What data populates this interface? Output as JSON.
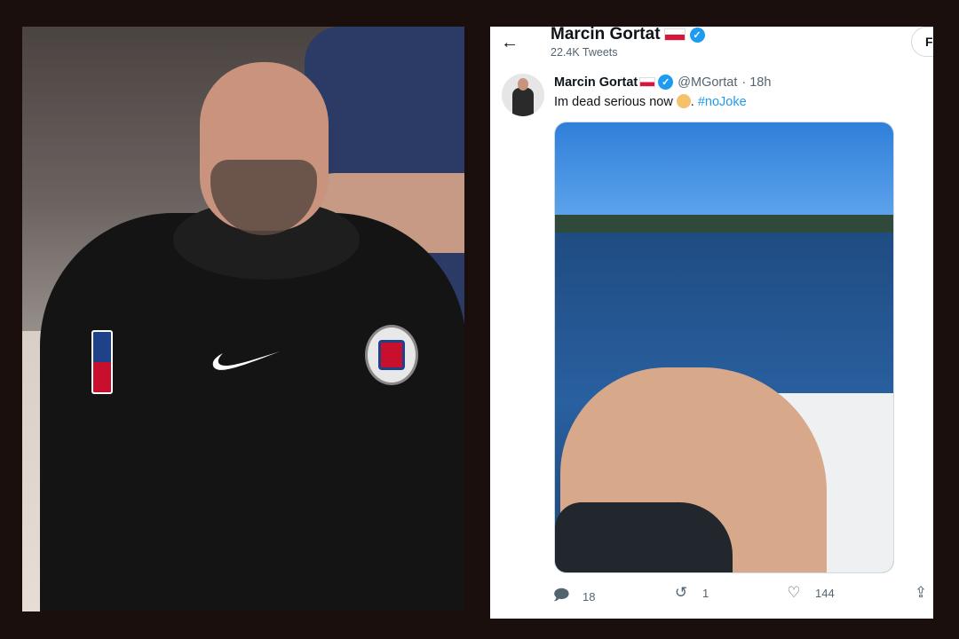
{
  "header": {
    "back_icon": "arrow-left-icon",
    "name": "Marcin Gortat",
    "tweet_count": "22.4K Tweets",
    "follow_label": "F"
  },
  "tweet": {
    "name": "Marcin Gortat",
    "handle": "@MGortat",
    "time": "· 18h",
    "text": "Im dead serious now",
    "text_sep": ". ",
    "hashtag": "#noJoke"
  },
  "actions": {
    "reply_count": "18",
    "retweet_count": "1",
    "like_count": "144"
  },
  "colors": {
    "verified": "#1d9bf0",
    "hashtag": "#1d9bf0",
    "muted": "#536471",
    "page_bg": "#1a0f0c"
  }
}
